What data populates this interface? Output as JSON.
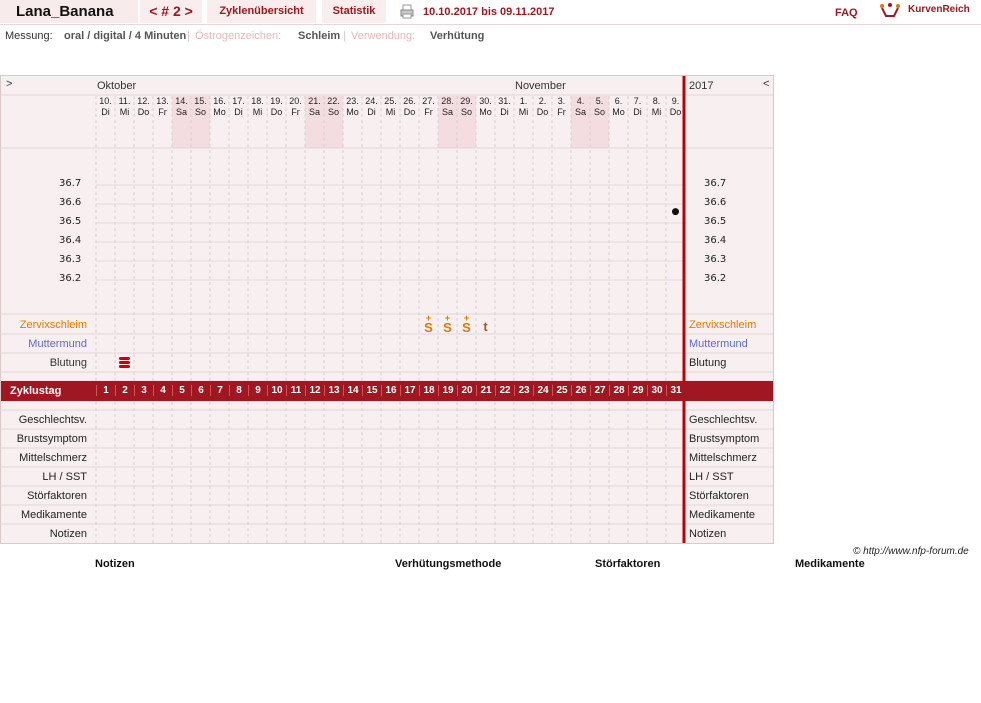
{
  "header": {
    "username": "Lana_Banana",
    "cycle_nav": "< # 2 >",
    "nav_overview": "Zyklenübersicht",
    "nav_stats": "Statistik",
    "date_range": "10.10.2017 bis 09.11.2017",
    "faq": "FAQ",
    "brand": "KurvenReich"
  },
  "meta": {
    "messung_label": "Messung:",
    "messung_value": "oral / digital / 4 Minuten",
    "oestrogen_label": "Östrogenzeichen:",
    "oestrogen_value": "Schleim",
    "verwendung_label": "Verwendung:",
    "verwendung_value": "Verhütung"
  },
  "chart": {
    "nav_left": ">",
    "nav_right": "<",
    "month1": "Oktober",
    "month2": "November",
    "year": "2017",
    "days": [
      {
        "d": "10.",
        "w": "Di",
        "we": false
      },
      {
        "d": "11.",
        "w": "Mi",
        "we": false
      },
      {
        "d": "12.",
        "w": "Do",
        "we": false
      },
      {
        "d": "13.",
        "w": "Fr",
        "we": false
      },
      {
        "d": "14.",
        "w": "Sa",
        "we": true
      },
      {
        "d": "15.",
        "w": "So",
        "we": true
      },
      {
        "d": "16.",
        "w": "Mo",
        "we": false
      },
      {
        "d": "17.",
        "w": "Di",
        "we": false
      },
      {
        "d": "18.",
        "w": "Mi",
        "we": false
      },
      {
        "d": "19.",
        "w": "Do",
        "we": false
      },
      {
        "d": "20.",
        "w": "Fr",
        "we": false
      },
      {
        "d": "21.",
        "w": "Sa",
        "we": true
      },
      {
        "d": "22.",
        "w": "So",
        "we": true
      },
      {
        "d": "23.",
        "w": "Mo",
        "we": false
      },
      {
        "d": "24.",
        "w": "Di",
        "we": false
      },
      {
        "d": "25.",
        "w": "Mi",
        "we": false
      },
      {
        "d": "26.",
        "w": "Do",
        "we": false
      },
      {
        "d": "27.",
        "w": "Fr",
        "we": false
      },
      {
        "d": "28.",
        "w": "Sa",
        "we": true
      },
      {
        "d": "29.",
        "w": "So",
        "we": true
      },
      {
        "d": "30.",
        "w": "Mo",
        "we": false
      },
      {
        "d": "31.",
        "w": "Di",
        "we": false
      },
      {
        "d": "1.",
        "w": "Mi",
        "we": false
      },
      {
        "d": "2.",
        "w": "Do",
        "we": false
      },
      {
        "d": "3.",
        "w": "Fr",
        "we": false
      },
      {
        "d": "4.",
        "w": "Sa",
        "we": true
      },
      {
        "d": "5.",
        "w": "So",
        "we": true
      },
      {
        "d": "6.",
        "w": "Mo",
        "we": false
      },
      {
        "d": "7.",
        "w": "Di",
        "we": false
      },
      {
        "d": "8.",
        "w": "Mi",
        "we": false
      },
      {
        "d": "9.",
        "w": "Do",
        "we": false
      }
    ],
    "temp_ticks": [
      "36.7",
      "36.6",
      "36.5",
      "36.4",
      "36.3",
      "36.2"
    ],
    "temperatures": [
      {
        "day": 31,
        "temp": 36.56
      }
    ],
    "rows_upper": {
      "zervix": "Zervixschleim",
      "muttermund": "Muttermund",
      "blutung": "Blutung"
    },
    "zervix_marks": [
      {
        "day": 18,
        "symbol": "S"
      },
      {
        "day": 19,
        "symbol": "S"
      },
      {
        "day": 20,
        "symbol": "S"
      },
      {
        "day": 21,
        "symbol": "t"
      }
    ],
    "blutung_days": [
      2
    ],
    "zyklustag_label": "Zyklustag",
    "cycle_days": [
      "1",
      "2",
      "3",
      "4",
      "5",
      "6",
      "7",
      "8",
      "9",
      "10",
      "11",
      "12",
      "13",
      "14",
      "15",
      "16",
      "17",
      "18",
      "19",
      "20",
      "21",
      "22",
      "23",
      "24",
      "25",
      "26",
      "27",
      "28",
      "29",
      "30",
      "31"
    ],
    "rows_lower": [
      "Geschlechtsv.",
      "Brustsymptom",
      "Mittelschmerz",
      "LH / SST",
      "Störfaktoren",
      "Medikamente",
      "Notizen"
    ],
    "colors": {
      "accent": "#a01722",
      "weekend": "#f3dde0",
      "grid": "#d9d0d0",
      "cervix": "#e07b00",
      "mm": "#5b6ccc"
    }
  },
  "copyright": "© http://www.nfp-forum.de",
  "footer": {
    "notizen": "Notizen",
    "methode": "Verhütungsmethode",
    "stoerfaktoren": "Störfaktoren",
    "medikamente": "Medikamente"
  }
}
